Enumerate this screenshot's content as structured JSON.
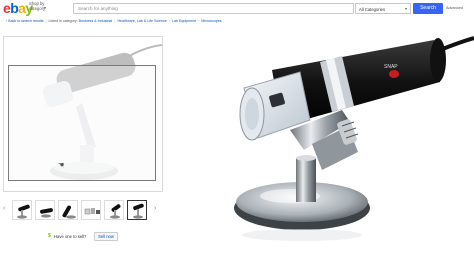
{
  "header": {
    "logo_letters": [
      "e",
      "b",
      "a",
      "y"
    ],
    "logo_colors": [
      "#e53238",
      "#0064d2",
      "#f5af02",
      "#86b817"
    ],
    "shop_by_category": "Shop by category",
    "search_placeholder": "Search for anything",
    "category_value": "All Categories",
    "search_button": "Search",
    "advanced_link": "Advanced"
  },
  "breadcrumb": {
    "back": "Back to search results",
    "listed_in": "Listed in category:",
    "items": [
      "Business & Industrial",
      "Healthcare, Lab & Life Science",
      "Lab Equipment",
      "Microscopes"
    ]
  },
  "zoom": {
    "snap_label": "SNAP"
  },
  "thumbnails": {
    "count": 6,
    "selected_index": 5
  },
  "sell": {
    "question": "Have one to sell?",
    "button": "Sell now"
  },
  "colors": {
    "accent": "#3665f3",
    "link": "#0654ba"
  }
}
